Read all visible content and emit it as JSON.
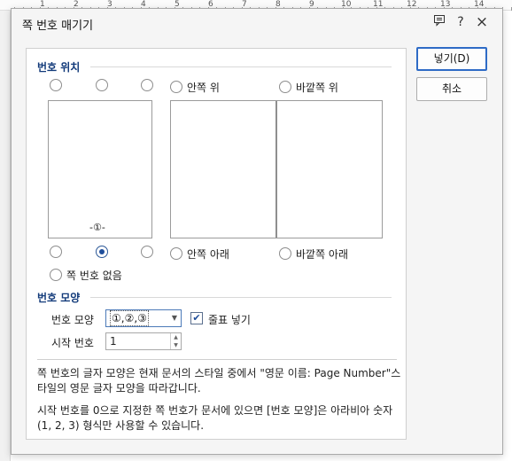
{
  "ruler": {
    "numbers": [
      "1",
      "2",
      "3",
      "4",
      "5",
      "6",
      "7",
      "8",
      "9",
      "10",
      "11",
      "12",
      "13",
      "14"
    ]
  },
  "dialog": {
    "title": "쪽 번호 매기기",
    "title_buttons": {
      "help": "?",
      "close": "×"
    }
  },
  "position_group": {
    "label": "번호 위치",
    "options": {
      "inner_top": "안쪽 위",
      "outer_top": "바깥쪽 위",
      "inner_bottom": "안쪽 아래",
      "outer_bottom": "바깥쪽 아래",
      "none": "쪽 번호 없음"
    },
    "selected": "bottom-center",
    "preview_number": "-①-"
  },
  "format_group": {
    "label": "번호 모양",
    "format_label": "번호 모양",
    "format_value": "①,②,③",
    "include_decoration_label": "줄표 넣기",
    "include_decoration_checked": true,
    "start_label": "시작 번호",
    "start_value": "1"
  },
  "notes": {
    "note1": "쪽 번호의 글자 모양은 현재 문서의 스타일 중에서 \"영문 이름: Page Number\"스타일의 영문 글자 모양을 따라갑니다.",
    "note2": "시작 번호를 0으로 지정한 쪽 번호가 문서에 있으면 [번호 모양]은 아라비아 숫자(1, 2, 3) 형식만 사용할 수 있습니다."
  },
  "buttons": {
    "insert": "넣기(D)",
    "cancel": "취소"
  },
  "colors": {
    "accent": "#2e6bc6",
    "group_label": "#123a7a"
  }
}
